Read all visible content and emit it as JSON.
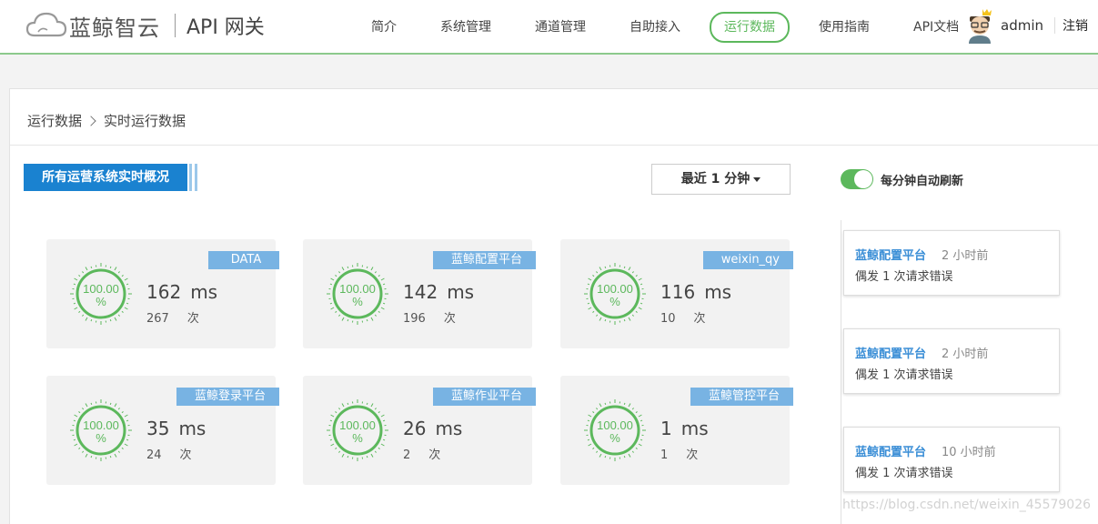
{
  "header": {
    "brand": "蓝鲸智云",
    "product": "API 网关",
    "nav": [
      {
        "label": "简介",
        "active": false
      },
      {
        "label": "系统管理",
        "active": false
      },
      {
        "label": "通道管理",
        "active": false
      },
      {
        "label": "自助接入",
        "active": false
      },
      {
        "label": "运行数据",
        "active": true
      },
      {
        "label": "使用指南",
        "active": false
      },
      {
        "label": "API文档",
        "active": false
      }
    ],
    "username": "admin",
    "logout": "注销"
  },
  "breadcrumb": {
    "parent": "运行数据",
    "current": "实时运行数据"
  },
  "controls": {
    "tab_label": "所有运营系统实时概况",
    "range_label": "最近 1 分钟",
    "auto_refresh_label": "每分钟自动刷新",
    "auto_refresh_on": true
  },
  "cards": [
    {
      "name": "DATA",
      "rate": "100.00",
      "pct": "%",
      "ms": "162",
      "ms_unit": "ms",
      "count": "267",
      "count_unit": "次"
    },
    {
      "name": "蓝鲸配置平台",
      "rate": "100.00",
      "pct": "%",
      "ms": "142",
      "ms_unit": "ms",
      "count": "196",
      "count_unit": "次"
    },
    {
      "name": "weixin_qy",
      "rate": "100.00",
      "pct": "%",
      "ms": "116",
      "ms_unit": "ms",
      "count": "10",
      "count_unit": "次"
    },
    {
      "name": "蓝鲸登录平台",
      "rate": "100.00",
      "pct": "%",
      "ms": "35",
      "ms_unit": "ms",
      "count": "24",
      "count_unit": "次"
    },
    {
      "name": "蓝鲸作业平台",
      "rate": "100.00",
      "pct": "%",
      "ms": "26",
      "ms_unit": "ms",
      "count": "2",
      "count_unit": "次"
    },
    {
      "name": "蓝鲸管控平台",
      "rate": "100.00",
      "pct": "%",
      "ms": "1",
      "ms_unit": "ms",
      "count": "1",
      "count_unit": "次"
    }
  ],
  "alerts": [
    {
      "system": "蓝鲸配置平台",
      "time": "2 小时前",
      "message": "偶发 1 次请求错误"
    },
    {
      "system": "蓝鲸配置平台",
      "time": "2 小时前",
      "message": "偶发 1 次请求错误"
    },
    {
      "system": "蓝鲸配置平台",
      "time": "10 小时前",
      "message": "偶发 1 次请求错误"
    }
  ],
  "watermark": "https://blog.csdn.net/weixin_45579026",
  "colors": {
    "accent": "#5cb85c",
    "primary": "#1a82d0",
    "tag": "#78b3e3",
    "link": "#3a8ed6"
  }
}
